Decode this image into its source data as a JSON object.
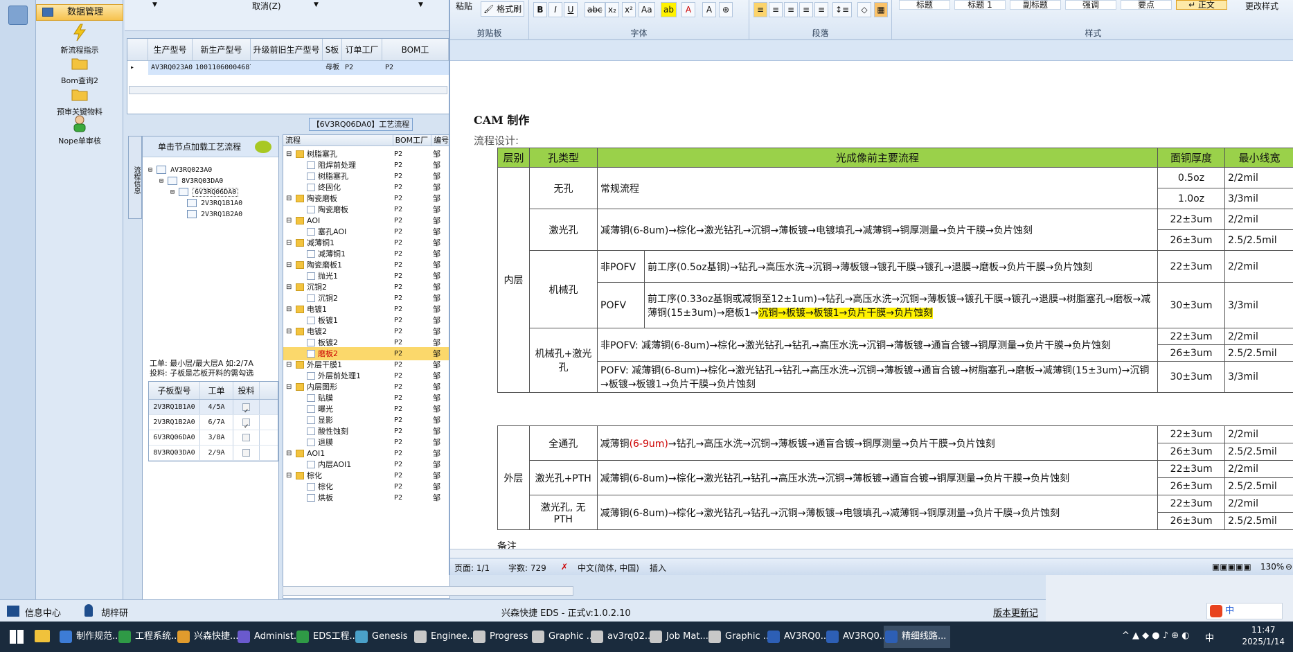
{
  "nav": {
    "header": "数据管理",
    "items": [
      {
        "label": "新流程指示",
        "icon": "lightning-icon"
      },
      {
        "label": "Bom查询2",
        "icon": "folder-icon"
      },
      {
        "label": "预审关键物料",
        "icon": "folder-icon"
      },
      {
        "label": "Nope单审核",
        "icon": "user-icon"
      }
    ]
  },
  "top": {
    "cancel_label": "取消(Z)"
  },
  "grid1": {
    "columns": [
      "生产型号",
      "新生产型号",
      "升级前旧生产型号",
      "S板",
      "订单工厂",
      "BOM工"
    ],
    "row": [
      "AV3RQ023A0",
      "10011060004687",
      "",
      "母板",
      "P2",
      "P2"
    ]
  },
  "flow_tab": "【6V3RQ06DA0】工艺流程",
  "vertical_tab": "流程信息",
  "tree": {
    "hint": "单击节点加载工艺流程",
    "nodes": [
      "AV3RQ023A0",
      "8V3RQ03DA0",
      "6V3RQ06DA0",
      "2V3RQ1B1A0",
      "2V3RQ1B2A0"
    ]
  },
  "info_line1": "工单: 最小层/最大层A 如:2/7A",
  "info_line2": "投料: 子板是芯板开料的需勾选",
  "subgrid": {
    "columns": [
      "子板型号",
      "工单",
      "投料"
    ],
    "rows": [
      {
        "model": "2V3RQ1B1A0",
        "order": "4/5A",
        "checked": true
      },
      {
        "model": "2V3RQ1B2A0",
        "order": "6/7A",
        "checked": true
      },
      {
        "model": "6V3RQ06DA0",
        "order": "3/8A",
        "checked": false
      },
      {
        "model": "8V3RQ03DA0",
        "order": "2/9A",
        "checked": false
      }
    ]
  },
  "proc": {
    "columns": [
      "流程",
      "BOM工厂",
      "编号"
    ],
    "rows": [
      {
        "level": 0,
        "type": "folder",
        "name": "树脂塞孔",
        "factory": "P2",
        "code": "邹"
      },
      {
        "level": 1,
        "type": "doc",
        "name": "阻焊前处理",
        "factory": "P2",
        "code": "邹"
      },
      {
        "level": 1,
        "type": "doc",
        "name": "树脂塞孔",
        "factory": "P2",
        "code": "邹"
      },
      {
        "level": 1,
        "type": "doc",
        "name": "终固化",
        "factory": "P2",
        "code": "邹"
      },
      {
        "level": 0,
        "type": "folder",
        "name": "陶瓷磨板",
        "factory": "P2",
        "code": "邹"
      },
      {
        "level": 1,
        "type": "doc",
        "name": "陶瓷磨板",
        "factory": "P2",
        "code": "邹"
      },
      {
        "level": 0,
        "type": "folder",
        "name": "AOI",
        "factory": "P2",
        "code": "邹"
      },
      {
        "level": 1,
        "type": "doc",
        "name": "塞孔AOI",
        "factory": "P2",
        "code": "邹"
      },
      {
        "level": 0,
        "type": "folder",
        "name": "减薄铜1",
        "factory": "P2",
        "code": "邹"
      },
      {
        "level": 1,
        "type": "doc",
        "name": "减薄铜1",
        "factory": "P2",
        "code": "邹"
      },
      {
        "level": 0,
        "type": "folder",
        "name": "陶瓷磨板1",
        "factory": "P2",
        "code": "邹"
      },
      {
        "level": 1,
        "type": "doc",
        "name": "抛光1",
        "factory": "P2",
        "code": "邹"
      },
      {
        "level": 0,
        "type": "folder",
        "name": "沉铜2",
        "factory": "P2",
        "code": "邹"
      },
      {
        "level": 1,
        "type": "doc",
        "name": "沉铜2",
        "factory": "P2",
        "code": "邹"
      },
      {
        "level": 0,
        "type": "folder",
        "name": "电镀1",
        "factory": "P2",
        "code": "邹"
      },
      {
        "level": 1,
        "type": "doc",
        "name": "板镀1",
        "factory": "P2",
        "code": "邹"
      },
      {
        "level": 0,
        "type": "folder",
        "name": "电镀2",
        "factory": "P2",
        "code": "邹"
      },
      {
        "level": 1,
        "type": "doc",
        "name": "板镀2",
        "factory": "P2",
        "code": "邹"
      },
      {
        "level": 1,
        "type": "doc",
        "name": "磨板2",
        "factory": "P2",
        "code": "邹",
        "selected": true
      },
      {
        "level": 0,
        "type": "folder",
        "name": "外层干膜1",
        "factory": "P2",
        "code": "邹"
      },
      {
        "level": 1,
        "type": "doc",
        "name": "外层前处理1",
        "factory": "P2",
        "code": "邹"
      },
      {
        "level": 0,
        "type": "folder",
        "name": "内层图形",
        "factory": "P2",
        "code": "邹"
      },
      {
        "level": 1,
        "type": "doc",
        "name": "贴膜",
        "factory": "P2",
        "code": "邹"
      },
      {
        "level": 1,
        "type": "doc",
        "name": "曝光",
        "factory": "P2",
        "code": "邹"
      },
      {
        "level": 1,
        "type": "doc",
        "name": "显影",
        "factory": "P2",
        "code": "邹"
      },
      {
        "level": 1,
        "type": "doc",
        "name": "酸性蚀刻",
        "factory": "P2",
        "code": "邹"
      },
      {
        "level": 1,
        "type": "doc",
        "name": "退膜",
        "factory": "P2",
        "code": "邹"
      },
      {
        "level": 0,
        "type": "folder",
        "name": "AOI1",
        "factory": "P2",
        "code": "邹"
      },
      {
        "level": 1,
        "type": "doc",
        "name": "内层AOI1",
        "factory": "P2",
        "code": "邹"
      },
      {
        "level": 0,
        "type": "folder",
        "name": "棕化",
        "factory": "P2",
        "code": "邹"
      },
      {
        "level": 1,
        "type": "doc",
        "name": "棕化",
        "factory": "P2",
        "code": "邹"
      },
      {
        "level": 1,
        "type": "doc",
        "name": "烘板",
        "factory": "P2",
        "code": "邹"
      }
    ]
  },
  "appstatus": {
    "info_center": "信息中心",
    "user": "胡梓研",
    "version": "兴森快捷 EDS - 正式v:1.0.2.10",
    "update_link": "版本更新记录"
  },
  "ribbon": {
    "groups": [
      "剪贴板",
      "字体",
      "段落",
      "样式"
    ],
    "paste": "粘贴",
    "format_painter": "格式刷",
    "styles": [
      "标题",
      "标题 1",
      "副标题",
      "强调",
      "要点",
      "↵ 正文"
    ],
    "change_styles": "更改样式"
  },
  "doc": {
    "title": "CAM 制作",
    "subtitle": "流程设计:",
    "headers": [
      "层别",
      "孔类型",
      "光成像前主要流程",
      "面铜厚度",
      "最小线宽"
    ],
    "inner_label": "内层",
    "outer_label": "外层",
    "rows": {
      "no_hole": {
        "type": "无孔",
        "flow": "常规流程",
        "t1": "0.5oz",
        "w1": "2/2mil",
        "t2": "1.0oz",
        "w2": "3/3mil"
      },
      "laser": {
        "type": "激光孔",
        "flow": "减薄铜(6-8um)→棕化→激光钻孔→沉铜→薄板镀→电镀填孔→减薄铜→铜厚测量→负片干膜→负片蚀刻",
        "t1": "22±3um",
        "w1": "2/2mil",
        "t2": "26±3um",
        "w2": "2.5/2.5mil"
      },
      "mech": {
        "type": "机械孔",
        "sub1": "非POFV",
        "flow1": "前工序(0.5oz基铜)→钻孔→高压水洗→沉铜→薄板镀→镀孔干膜→镀孔→退膜→磨板→负片干膜→负片蚀刻",
        "t1": "22±3um",
        "w1": "2/2mil",
        "sub2": "POFV",
        "flow2a": "前工序(0.33oz基铜或减铜至12±1um)→钻孔→高压水洗→沉铜→薄板镀→镀孔干膜→镀孔→退膜→树脂塞孔→磨板→减薄铜(15±3um)→磨板1→",
        "flow2b": "沉铜→板镀→板镀1→负片干膜→负片蚀刻",
        "t2": "30±3um",
        "w2": "3/3mil"
      },
      "mech_laser": {
        "type": "机械孔+激光孔",
        "flow1": "非POFV: 减薄铜(6-8um)→棕化→激光钻孔→钻孔→高压水洗→沉铜→薄板镀→通盲合镀→铜厚测量→负片干膜→负片蚀刻",
        "t1": "22±3um",
        "w1": "2/2mil",
        "t2": "26±3um",
        "w2": "2.5/2.5mil",
        "flow2": "POFV: 减薄铜(6-8um)→棕化→激光钻孔→钻孔→高压水洗→沉铜→薄板镀→通盲合镀→树脂塞孔→磨板→减薄铜(15±3um)→沉铜→板镀→板镀1→负片干膜→负片蚀刻",
        "t3": "30±3um",
        "w3": "3/3mil"
      },
      "through": {
        "type": "全通孔",
        "flow_a": "减薄铜",
        "flow_red": "(6-9um)",
        "flow_b": "→钻孔→高压水洗→沉铜→薄板镀→通盲合镀→铜厚测量→负片干膜→负片蚀刻",
        "t1": "22±3um",
        "w1": "2/2mil",
        "t2": "26±3um",
        "w2": "2.5/2.5mil"
      },
      "laser_pth": {
        "type": "激光孔+PTH",
        "flow": "减薄铜(6-8um)→棕化→激光钻孔→钻孔→高压水洗→沉铜→薄板镀→通盲合镀→铜厚测量→负片干膜→负片蚀刻",
        "t1": "22±3um",
        "w1": "2/2mil",
        "t2": "26±3um",
        "w2": "2.5/2.5mil"
      },
      "laser_nopth": {
        "type": "激光孔, 无PTH",
        "flow": "减薄铜(6-8um)→棕化→激光钻孔→钻孔→沉铜→薄板镀→电镀填孔→减薄铜→铜厚测量→负片干膜→负片蚀刻",
        "t1": "22±3um",
        "w1": "2/2mil",
        "t2": "26±3um",
        "w2": "2.5/2.5mil"
      }
    },
    "note": "备注"
  },
  "wstatus": {
    "page": "页面: 1/1",
    "words": "字数: 729",
    "lang": "中文(简体, 中国)",
    "mode": "插入",
    "zoom": "130%"
  },
  "taskbar": {
    "items": [
      {
        "label": "制作规范...",
        "color": "#3d7cd6"
      },
      {
        "label": "工程系统...",
        "color": "#2f9a46"
      },
      {
        "label": "兴森快捷...",
        "color": "#e09b2d"
      },
      {
        "label": "Administ...",
        "color": "#6a5acd"
      },
      {
        "label": "EDS工程...",
        "color": "#2f9a46"
      },
      {
        "label": "Genesis",
        "color": "#4aa0c8"
      },
      {
        "label": "Enginee...",
        "color": "#c8c8c8"
      },
      {
        "label": "Progress",
        "color": "#c8c8c8"
      },
      {
        "label": "Graphic ...",
        "color": "#c8c8c8"
      },
      {
        "label": "av3rq02...",
        "color": "#c8c8c8"
      },
      {
        "label": "Job Mat...",
        "color": "#c8c8c8"
      },
      {
        "label": "Graphic ...",
        "color": "#c8c8c8"
      },
      {
        "label": "AV3RQ0...",
        "color": "#2d5fb5"
      },
      {
        "label": "AV3RQ0...",
        "color": "#2d5fb5"
      },
      {
        "label": "精细线路...",
        "color": "#2d5fb5"
      }
    ],
    "ime": "中",
    "time": "11:47",
    "date": "2025/1/14"
  }
}
